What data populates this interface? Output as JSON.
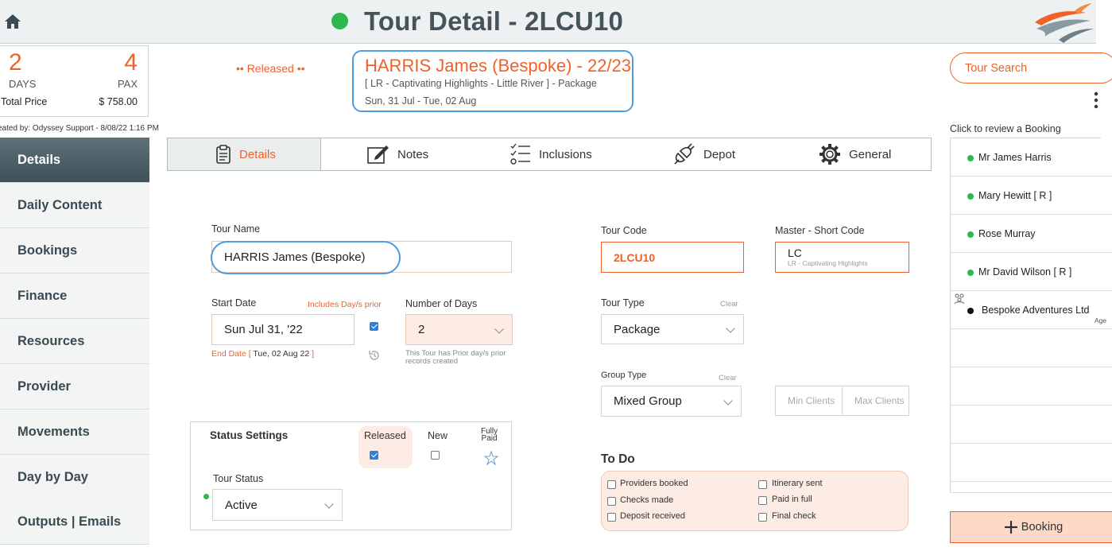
{
  "header": {
    "title": "Tour Detail - 2LCU10",
    "status_color": "#2db84b"
  },
  "summary": {
    "days_value": "2",
    "days_label": "DAYS",
    "pax_value": "4",
    "pax_label": "PAX",
    "total_price_label": "Total Price",
    "total_price_value": "$ 758.00",
    "created_by": "eated by: Odyssey Support - 8/08/22 1:16 PM"
  },
  "status_text": "•• Released ••",
  "tour_header": {
    "title": "HARRIS James (Bespoke) - 22/23",
    "subtitle": "[ LR - Captivating Highlights - Little River ] - Package",
    "dates": "Sun, 31 Jul  - Tue, 02 Aug"
  },
  "sidebar": {
    "items": [
      {
        "label": "Details"
      },
      {
        "label": "Daily Content"
      },
      {
        "label": "Bookings"
      },
      {
        "label": "Finance"
      },
      {
        "label": "Resources"
      },
      {
        "label": "Provider"
      },
      {
        "label": "Movements"
      },
      {
        "label": "Day by Day"
      },
      {
        "label": "Outputs | Emails"
      }
    ]
  },
  "tabs": [
    {
      "label": "Details",
      "icon": "clipboard-icon"
    },
    {
      "label": "Notes",
      "icon": "edit-note-icon"
    },
    {
      "label": "Inclusions",
      "icon": "checklist-icon"
    },
    {
      "label": "Depot",
      "icon": "plug-icon"
    },
    {
      "label": "General",
      "icon": "gear-icon"
    }
  ],
  "form": {
    "tour_name_label": "Tour Name",
    "tour_name_value": "HARRIS James (Bespoke)",
    "start_date_label": "Start Date",
    "includes_prior_label": "Includes Day/s prior",
    "start_date_value": "Sun Jul 31, '22",
    "end_date_label": "End Date [",
    "end_date_value": "Tue, 02 Aug 22",
    "end_date_close": "]",
    "num_days_label": "Number of Days",
    "num_days_value": "2",
    "prior_note": "This Tour has Prior day/s prior records created",
    "tour_code_label": "Tour Code",
    "tour_code_value": "2LCU10",
    "master_code_label": "Master - Short Code",
    "master_code_value": "LC",
    "master_code_sub": "LR - Captivating Highlights",
    "tour_type_label": "Tour Type",
    "tour_type_value": "Package",
    "clear_label": "Clear",
    "group_type_label": "Group Type",
    "group_type_value": "Mixed Group",
    "min_clients_placeholder": "Min Clients",
    "max_clients_placeholder": "Max Clients"
  },
  "status_settings": {
    "title": "Status Settings",
    "released_label": "Released",
    "new_label": "New",
    "fully_paid_label_1": "Fully",
    "fully_paid_label_2": "Paid",
    "tour_status_label": "Tour Status",
    "tour_status_value": "Active"
  },
  "todo": {
    "title": "To Do",
    "items": [
      {
        "label": "Providers booked"
      },
      {
        "label": "Checks made"
      },
      {
        "label": "Deposit received"
      },
      {
        "label": "Itinerary sent"
      },
      {
        "label": "Paid in full"
      },
      {
        "label": "Final check"
      }
    ]
  },
  "right_panel": {
    "tour_search_label": "Tour Search",
    "click_review_label": "Click to review a Booking",
    "bookings": [
      {
        "name": "Mr James Harris",
        "status_color": "#2db84b"
      },
      {
        "name": "Mary Hewitt  [ R ]",
        "status_color": "#2db84b"
      },
      {
        "name": "Rose Murray",
        "status_color": "#2db84b"
      },
      {
        "name": "Mr David Wilson  [ R ]",
        "status_color": "#2db84b"
      },
      {
        "name": "Bespoke Adventures Ltd",
        "status_color": "#111111",
        "tag": "Age",
        "icon": "group-icon"
      }
    ],
    "add_booking_label": "Booking"
  },
  "colors": {
    "accent": "#f0612a",
    "header_bg": "#eef1f1",
    "sidebar_active": "#4b5d64"
  }
}
